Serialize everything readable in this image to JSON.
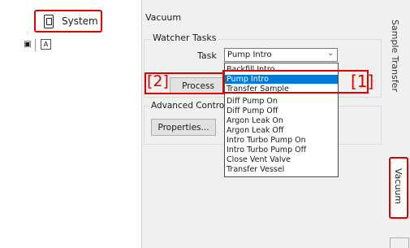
{
  "left_panel": {
    "system_tab_label": "System",
    "toolbar_icons": [
      "pin-icon",
      "properties-icon"
    ]
  },
  "main": {
    "section_title": "Vacuum",
    "watcher_tasks": {
      "group_title": "Watcher Tasks",
      "task_label": "Task",
      "task_selected": "Pump Intro",
      "process_button": "Process",
      "task_options": [
        "Backfill Intro",
        "Pump Intro",
        "Transfer Sample",
        "Diff Pump On",
        "Diff Pump Off",
        "Argon Leak On",
        "Argon Leak Off",
        "Intro Turbo Pump On",
        "Intro Turbo Pump Off",
        "Close Vent Valve",
        "Transfer Vessel"
      ]
    },
    "advanced_control": {
      "group_title": "Advanced Control",
      "properties_button": "Properties..."
    }
  },
  "callouts": {
    "one": "[1]",
    "two": "[2]"
  },
  "right_tabs": {
    "sample_transfer": "Sample Transfer",
    "vacuum": "Vacuum"
  },
  "colors": {
    "callout": "#e00000",
    "selection": "#0078d7"
  }
}
